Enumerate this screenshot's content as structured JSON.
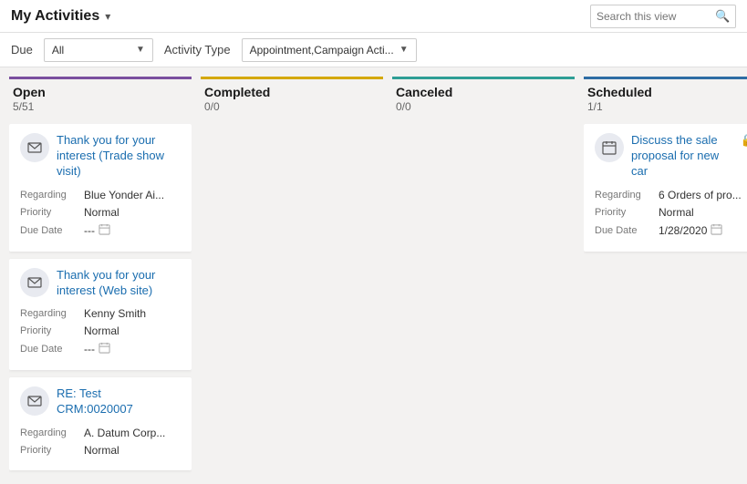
{
  "header": {
    "title": "My Activities",
    "chevron": "▾",
    "search_placeholder": "Search this view",
    "search_icon": "🔍"
  },
  "filters": {
    "due_label": "Due",
    "due_value": "All",
    "activity_type_label": "Activity Type",
    "activity_type_value": "Appointment,Campaign Acti..."
  },
  "columns": [
    {
      "id": "open",
      "title": "Open",
      "count": "5/51",
      "color_class": "open",
      "cards": [
        {
          "icon": "email",
          "title": "Thank you for your interest (Trade show visit)",
          "fields": [
            {
              "label": "Regarding",
              "value": "Blue Yonder Ai...",
              "type": "text"
            },
            {
              "label": "Priority",
              "value": "Normal",
              "type": "text"
            },
            {
              "label": "Due Date",
              "value": "---",
              "type": "date"
            }
          ],
          "lock": false
        },
        {
          "icon": "email",
          "title": "Thank you for your interest (Web site)",
          "fields": [
            {
              "label": "Regarding",
              "value": "Kenny Smith",
              "type": "text"
            },
            {
              "label": "Priority",
              "value": "Normal",
              "type": "text"
            },
            {
              "label": "Due Date",
              "value": "---",
              "type": "date"
            }
          ],
          "lock": false
        },
        {
          "icon": "email",
          "title": "RE: Test CRM:0020007",
          "fields": [
            {
              "label": "Regarding",
              "value": "A. Datum Corp...",
              "type": "text"
            },
            {
              "label": "Priority",
              "value": "Normal",
              "type": "text"
            }
          ],
          "lock": false
        }
      ]
    },
    {
      "id": "completed",
      "title": "Completed",
      "count": "0/0",
      "color_class": "completed",
      "cards": []
    },
    {
      "id": "canceled",
      "title": "Canceled",
      "count": "0/0",
      "color_class": "canceled",
      "cards": []
    },
    {
      "id": "scheduled",
      "title": "Scheduled",
      "count": "1/1",
      "color_class": "scheduled",
      "cards": [
        {
          "icon": "appointment",
          "title": "Discuss the sale proposal for new car",
          "fields": [
            {
              "label": "Regarding",
              "value": "6 Orders of pro...",
              "type": "text"
            },
            {
              "label": "Priority",
              "value": "Normal",
              "type": "text"
            },
            {
              "label": "Due Date",
              "value": "1/28/2020",
              "type": "date"
            }
          ],
          "lock": true
        }
      ]
    }
  ]
}
